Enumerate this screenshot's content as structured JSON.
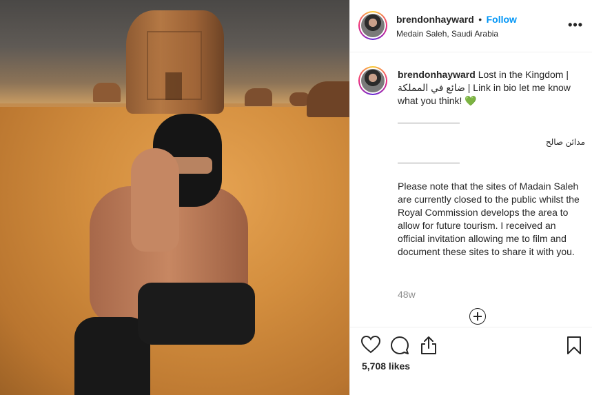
{
  "post": {
    "username": "brendonhayward",
    "separator": "•",
    "follow_label": "Follow",
    "location": "Medain Saleh, Saudi Arabia",
    "more_label": "•••"
  },
  "caption": {
    "username": "brendonhayward",
    "text_part1": "Lost in the Kingdom |",
    "text_arabic": "ضائع في المملكة",
    "text_part2": "| Link in bio let me know what you think!",
    "heart": "💚",
    "rule1": "___________",
    "arabic_name": "مدائن صالح",
    "rule2": "___________",
    "note": "Please note that the sites of Madain Saleh are currently closed to the public whilst the Royal Commission develops the area to allow for future tourism. I received an official invitation allowing me to film and document these sites to share it with you."
  },
  "meta": {
    "time_ago": "48w",
    "likes": "5,708 likes"
  },
  "icons": {
    "like": "heart-icon",
    "comment": "comment-icon",
    "share": "share-icon",
    "save": "bookmark-icon",
    "load_more": "plus-circle-icon",
    "more": "more-options-icon"
  },
  "colors": {
    "follow": "#0095f6",
    "text": "#262626",
    "muted": "#8e8e8e",
    "heart": "#5fd35a"
  }
}
